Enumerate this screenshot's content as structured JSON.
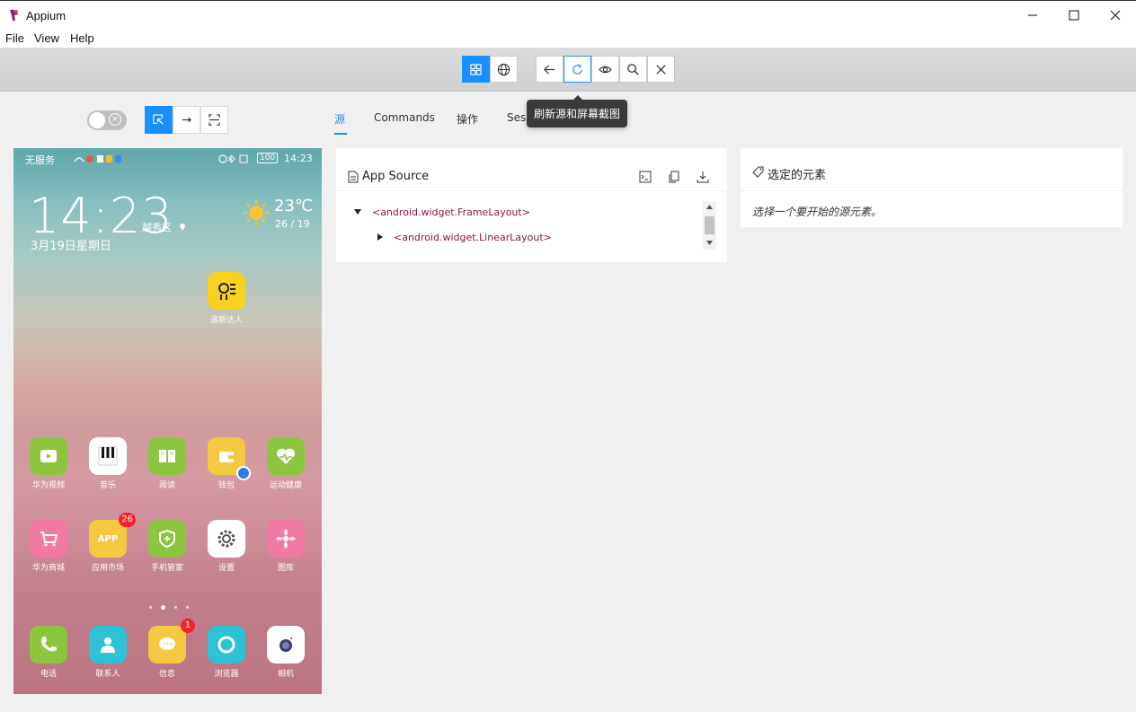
{
  "window": {
    "title": "Appium"
  },
  "menu": {
    "items": [
      "File",
      "View",
      "Help"
    ]
  },
  "toolbar": {
    "tooltip": "刷新源和屏幕截图"
  },
  "tabs": [
    "源",
    "Commands",
    "操作",
    "Session"
  ],
  "phone": {
    "status_left": "无服务",
    "status_battery": "100",
    "status_time": "14:23",
    "clock": "14:23",
    "location": "越秀区",
    "date": "3月19日星期日",
    "temperature": "23℃",
    "temp_range": "26 / 19",
    "apps": [
      {
        "label": "追新达人"
      },
      {
        "label": "华为视频"
      },
      {
        "label": "音乐"
      },
      {
        "label": "阅读"
      },
      {
        "label": "钱包"
      },
      {
        "label": "运动健康"
      },
      {
        "label": "华为商城"
      },
      {
        "label": "应用市场",
        "badge": "26",
        "icon_text": "APP"
      },
      {
        "label": "手机管家"
      },
      {
        "label": "设置"
      },
      {
        "label": "图库"
      },
      {
        "label": "电话"
      },
      {
        "label": "联系人"
      },
      {
        "label": "信息",
        "badge": "1"
      },
      {
        "label": "浏览器"
      },
      {
        "label": "相机"
      }
    ]
  },
  "source_panel": {
    "title": "App Source",
    "nodes": [
      "<android.widget.FrameLayout>",
      "<android.widget.LinearLayout>"
    ]
  },
  "selected_panel": {
    "title": "选定的元素",
    "hint": "选择一个要开始的源元素。"
  },
  "colors": {
    "accent": "#1890ff",
    "tree_text": "#8b1a3a"
  }
}
